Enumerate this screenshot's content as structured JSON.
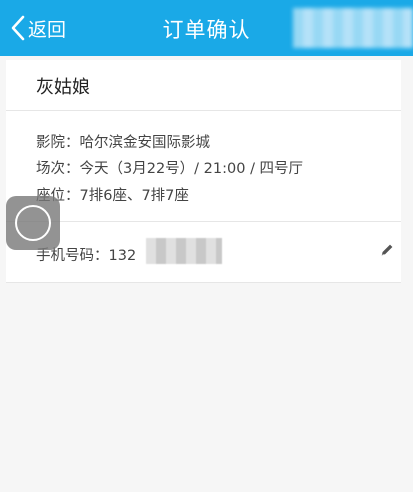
{
  "header": {
    "back_label": "返回",
    "title": "订单确认"
  },
  "order": {
    "movie": "灰姑娘",
    "cinema": "影院：哈尔滨金安国际影城",
    "showtime": "场次：今天（3月22号）/ 21:00 / 四号厅",
    "seats": "座位：7排6座、7排7座",
    "phone_label": "手机号码：132"
  },
  "colors": {
    "header": "#1aa9e7",
    "background": "#f6f6f6"
  }
}
